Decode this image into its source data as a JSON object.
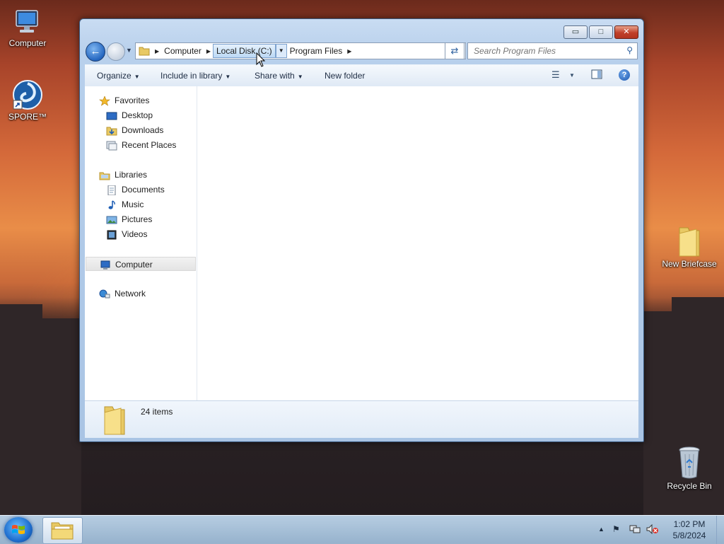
{
  "desktop": {
    "icons": [
      {
        "label": "Computer"
      },
      {
        "label": "SPORE™"
      },
      {
        "label": "New Briefcase"
      },
      {
        "label": "Recycle Bin"
      }
    ]
  },
  "window": {
    "caption_buttons": {
      "minimize": "▭",
      "maximize": "□",
      "close": "✕"
    },
    "address": {
      "crumbs": [
        "Computer",
        "Local Disk (C:)",
        "Program Files"
      ],
      "active_crumb": "Local Disk (C:)"
    },
    "search": {
      "placeholder": "Search Program Files"
    },
    "toolbar": {
      "organize": "Organize",
      "include_in_library": "Include in library",
      "share_with": "Share with",
      "new_folder": "New folder",
      "help": "?"
    },
    "nav": {
      "favorites": "Favorites",
      "desktop": "Desktop",
      "downloads": "Downloads",
      "recent_places": "Recent Places",
      "libraries": "Libraries",
      "documents": "Documents",
      "music": "Music",
      "pictures": "Pictures",
      "videos": "Videos",
      "computer": "Computer",
      "network": "Network"
    },
    "details": {
      "item_count": "24 items"
    }
  },
  "taskbar": {
    "clock_time": "1:02 PM",
    "clock_date": "5/8/2024"
  },
  "colors": {
    "accent": "#1f6fcf",
    "close_red": "#c0402a"
  }
}
